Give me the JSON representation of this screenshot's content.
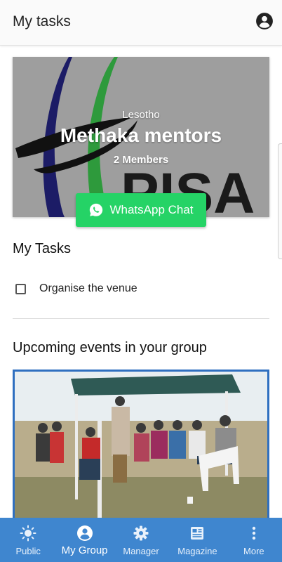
{
  "appbar": {
    "title": "My tasks",
    "account_icon": "account-circle-icon"
  },
  "group": {
    "country": "Lesotho",
    "name": "Methaka mentors",
    "members": "2 Members",
    "logo_text": "PISA",
    "whatsapp_label": "WhatsApp Chat",
    "whatsapp_color": "#25d366"
  },
  "tasks": {
    "heading": "My Tasks",
    "items": [
      {
        "label": "Organise the venue",
        "checked": false
      }
    ]
  },
  "events": {
    "heading": "Upcoming events in your group"
  },
  "nav": {
    "items": [
      {
        "label": "Public",
        "icon": "sun-icon"
      },
      {
        "label": "My Group",
        "icon": "account-circle-icon",
        "active": true
      },
      {
        "label": "Manager",
        "icon": "gear-icon"
      },
      {
        "label": "Magazine",
        "icon": "newspaper-icon"
      },
      {
        "label": "More",
        "icon": "more-vertical-icon"
      }
    ],
    "color": "#3f86cf"
  }
}
